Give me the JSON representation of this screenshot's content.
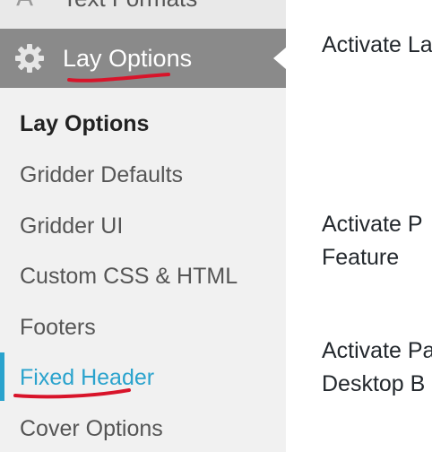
{
  "sidebar": {
    "previous_item": {
      "icon": "text-formats-icon",
      "label": "Text Formats"
    },
    "active_menu": {
      "icon": "gear-icon",
      "label": "Lay Options"
    },
    "submenu": [
      {
        "label": "Lay Options"
      },
      {
        "label": "Gridder Defaults"
      },
      {
        "label": "Gridder UI"
      },
      {
        "label": "Custom CSS & HTML"
      },
      {
        "label": "Footers"
      },
      {
        "label": "Fixed Header"
      },
      {
        "label": "Cover Options"
      }
    ]
  },
  "main": {
    "settings": [
      {
        "line1": "Activate La",
        "line2": ""
      },
      {
        "line1": "Activate P",
        "line2": "Feature"
      },
      {
        "line1": "Activate Pa",
        "line2": "Desktop B"
      }
    ]
  },
  "colors": {
    "sidebar_bg": "#f1f1f1",
    "active_menu_bg": "#8a8a8a",
    "current_link": "#2aa3cd",
    "annotation_red": "#d8142a"
  }
}
